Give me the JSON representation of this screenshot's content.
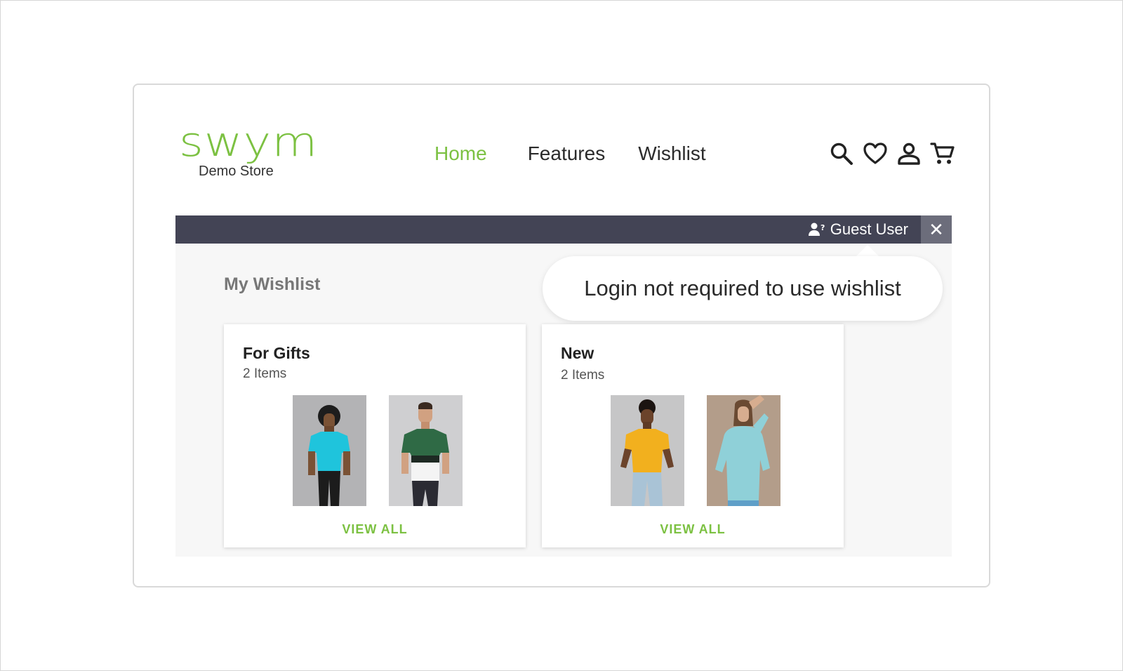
{
  "brand": {
    "logo_text": "swym",
    "subtitle": "Demo Store",
    "accent": "#7cc142"
  },
  "nav": {
    "items": [
      {
        "label": "Home",
        "active": true
      },
      {
        "label": "Features",
        "active": false
      },
      {
        "label": "Wishlist",
        "active": false
      }
    ]
  },
  "header_icons": [
    "search-icon",
    "heart-icon",
    "user-icon",
    "cart-icon"
  ],
  "guest_bar": {
    "label": "Guest User",
    "close": "✕",
    "bar_color": "#434455"
  },
  "wishlist": {
    "title": "My Wishlist",
    "tooltip": "Login not required to use wishlist",
    "lists": [
      {
        "name": "For Gifts",
        "count": "2 Items",
        "action": "VIEW ALL",
        "products": [
          "cyan t-shirt",
          "green color-block t-shirt"
        ]
      },
      {
        "name": "New",
        "count": "2 Items",
        "action": "VIEW ALL",
        "products": [
          "yellow t-shirt",
          "light blue hoodie"
        ]
      }
    ]
  }
}
